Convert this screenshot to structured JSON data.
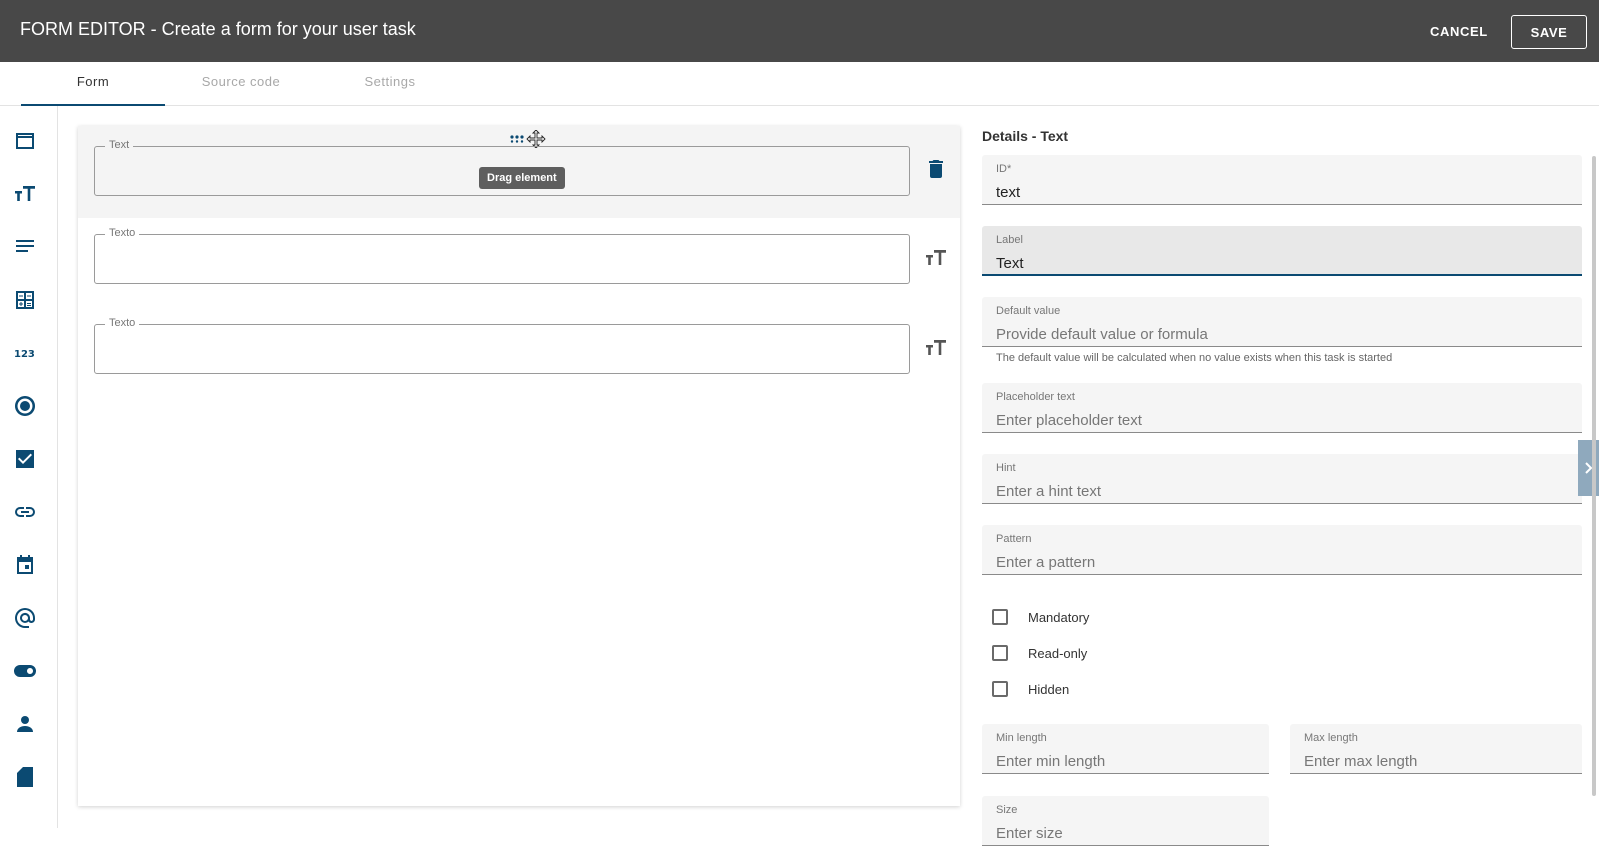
{
  "header": {
    "title": "FORM EDITOR - Create a form for your user task",
    "cancel_label": "CANCEL",
    "save_label": "SAVE"
  },
  "tabs": [
    {
      "label": "Form",
      "active": true
    },
    {
      "label": "Source code",
      "active": false
    },
    {
      "label": "Settings",
      "active": false
    }
  ],
  "toolbar": {
    "icons": [
      "layout-icon",
      "text-field-icon",
      "textarea-icon",
      "calculator-icon",
      "number-icon",
      "radio-icon",
      "checkbox-icon",
      "link-icon",
      "calendar-icon",
      "email-icon",
      "toggle-icon",
      "person-icon",
      "file-icon"
    ]
  },
  "canvas": {
    "rows": [
      {
        "label": "Text",
        "value": "",
        "selected": true,
        "action_icon": "delete-icon"
      },
      {
        "label": "Texto",
        "value": "",
        "selected": false,
        "action_icon": "text-field-icon"
      },
      {
        "label": "Texto",
        "value": "",
        "selected": false,
        "action_icon": "text-field-icon"
      }
    ],
    "tooltip": "Drag element"
  },
  "details": {
    "title": "Details - Text",
    "id": {
      "label": "ID*",
      "value": "text"
    },
    "label": {
      "label": "Label",
      "value": "Text"
    },
    "default_value": {
      "label": "Default value",
      "placeholder": "Provide default value or formula",
      "hint": "The default value will be calculated when no value exists when this task is started"
    },
    "placeholder_text": {
      "label": "Placeholder text",
      "placeholder": "Enter placeholder text"
    },
    "hint": {
      "label": "Hint",
      "placeholder": "Enter a hint text"
    },
    "pattern": {
      "label": "Pattern",
      "placeholder": "Enter a pattern"
    },
    "checkboxes": [
      {
        "label": "Mandatory",
        "checked": false
      },
      {
        "label": "Read-only",
        "checked": false
      },
      {
        "label": "Hidden",
        "checked": false
      }
    ],
    "min_length": {
      "label": "Min length",
      "placeholder": "Enter min length"
    },
    "max_length": {
      "label": "Max length",
      "placeholder": "Enter max length"
    },
    "size": {
      "label": "Size",
      "placeholder": "Enter size"
    }
  },
  "colors": {
    "header_bg": "#484848",
    "accent": "#0b4a72"
  }
}
